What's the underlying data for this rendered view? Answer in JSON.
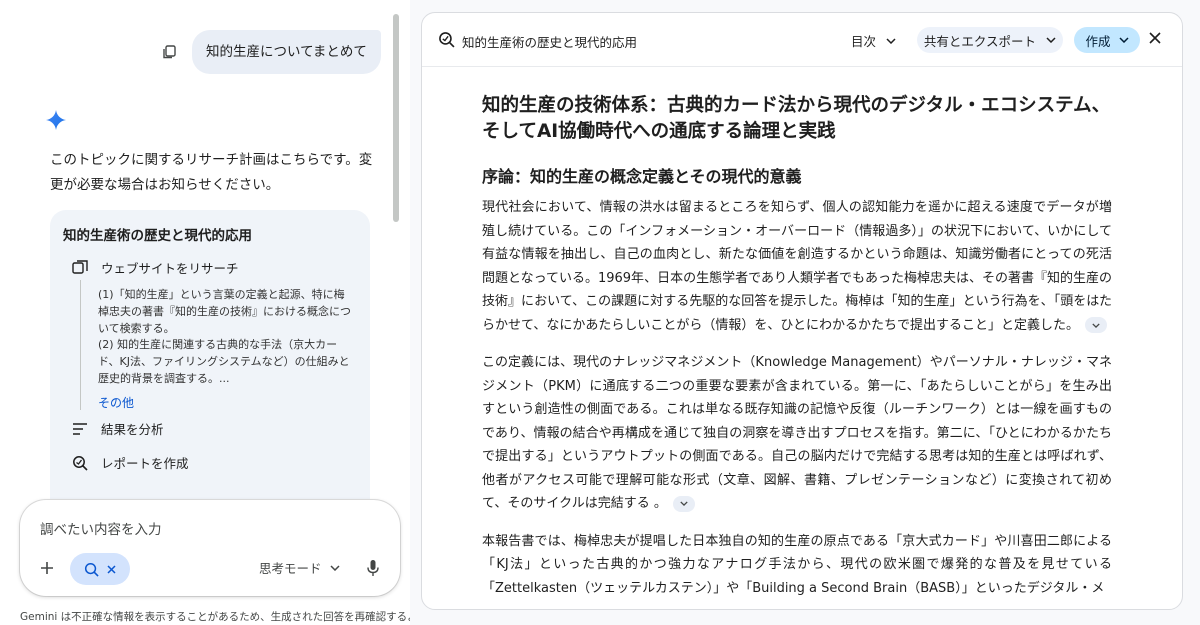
{
  "chat": {
    "user_message": "知的生産についてまとめて",
    "assistant_reply": "このトピックに関するリサーチ計画はこちらです。変更が必要な場合はお知らせください。",
    "plan": {
      "title": "知的生産術の歴史と現代的応用",
      "step1_label": "ウェブサイトをリサーチ",
      "step1_details": [
        "(1)「知的生産」という言葉の定義と起源、特に梅棹忠夫の著書『知的生産の技術』における概念について検索する。",
        "(2) 知的生産に関連する古典的な手法（京大カード、KJ法、ファイリングシステムなど）の仕組みと歴史的背景を調査する。..."
      ],
      "more_label": "その他",
      "step2_label": "結果を分析",
      "step3_label": "レポートを作成"
    }
  },
  "composer": {
    "placeholder": "調べたい内容を入力",
    "mode_label": "思考モード"
  },
  "disclaimer": "Gemini は不正確な情報を表示することがあるため、生成された回答を再確認するよ",
  "doc": {
    "header_title": "知的生産術の歴史と現代的応用",
    "toc_label": "目次",
    "share_label": "共有とエクスポート",
    "create_label": "作成",
    "h1": "知的生産の技術体系：古典的カード法から現代のデジタル・エコシステム、そしてAI協働時代への通底する論理と実践",
    "h2": "序論：知的生産の概念定義とその現代的意義",
    "paragraphs": [
      "現代社会において、情報の洪水は留まるところを知らず、個人の認知能力を遥かに超える速度でデータが増殖し続けている。この「インフォメーション・オーバーロード（情報過多）」の状況下において、いかにして有益な情報を抽出し、自己の血肉とし、新たな価値を創造するかという命題は、知識労働者にとっての死活問題となっている。1969年、日本の生態学者であり人類学者でもあった梅棹忠夫は、その著書『知的生産の技術』において、この課題に対する先駆的な回答を提示した。梅棹は「知的生産」という行為を、「頭をはたらかせて、なにかあたらしいことがら（情報）を、ひとにわかるかたちで提出すること」と定義した。",
      "この定義には、現代のナレッジマネジメント（Knowledge Management）やパーソナル・ナレッジ・マネジメント（PKM）に通底する二つの重要な要素が含まれている。第一に、「あたらしいことがら」を生み出すという創造性の側面である。これは単なる既存知識の記憶や反復（ルーチンワーク）とは一線を画すものであり、情報の結合や再構成を通じて独自の洞察を導き出すプロセスを指す。第二に、「ひとにわかるかたちで提出する」というアウトプットの側面である。自己の脳内だけで完結する思考は知的生産とは呼ばれず、他者がアクセス可能で理解可能な形式（文章、図解、書籍、プレゼンテーションなど）に変換されて初めて、そのサイクルは完結する 。",
      "本報告書では、梅棹忠夫が提唱した日本独自の知的生産の原点である「京大式カード」や川喜田二郎による「KJ法」といった古典的かつ強力なアナログ手法から、現代の欧米圏で爆発的な普及を見せている「Zettelkasten（ツェッテルカステン）」や「Building a Second Brain（BASB）」といったデジタル・メ"
    ]
  }
}
